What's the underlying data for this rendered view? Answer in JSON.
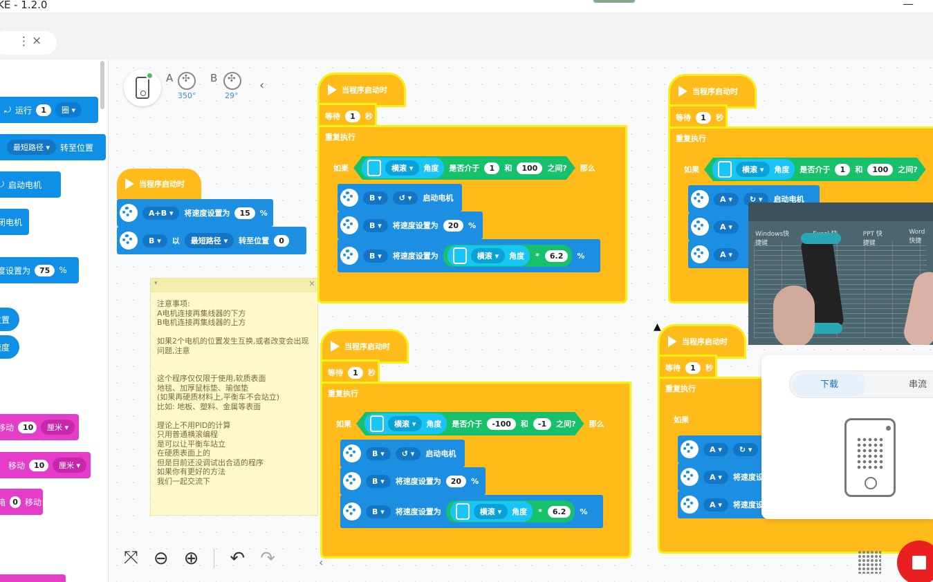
{
  "window": {
    "title": "KE - 1.2.0",
    "minimize": "—"
  },
  "tab": {
    "more": "⋮",
    "close": "×"
  },
  "palette": {
    "run_rotations_text": "运行",
    "run_value": "1",
    "run_unit": "圈",
    "shortest_path": "最短路径",
    "turn_to_position": "转至位置",
    "start_motor": "启动电机",
    "stop_motor": "关闭电机",
    "set_speed_text": "速度设置为",
    "set_speed_value": "75",
    "percent": "%",
    "position": "位置",
    "speed": "速度",
    "move_text": "移动",
    "move_value": "10",
    "move_unit": "厘米",
    "move2_text": "移动",
    "move2_value": "10",
    "move2_unit": "厘米",
    "move3_label": "箱",
    "move3_value": "0",
    "move3_text": "移动"
  },
  "hub_status": {
    "port_a": "A",
    "port_a_deg": "350°",
    "port_b": "B",
    "port_b_deg": "29°",
    "collapse": "‹"
  },
  "blocks": {
    "when_start": "当程序启动时",
    "wait": "等待",
    "wait_value": "1",
    "seconds": "秒",
    "repeat": "重复执行",
    "if": "如果",
    "then": "那么",
    "roll": "横滚",
    "angle": "角度",
    "is_between": "是否介于",
    "and": "和",
    "between_end": "之间?",
    "start_motor": "启动电机",
    "set_speed": "将速度设置为",
    "speed_20": "20",
    "percent": "%",
    "mult_symbol": "*",
    "mult_value": "6.2",
    "stack1": {
      "low": "1",
      "high": "100"
    },
    "stack2": {
      "low": "-100",
      "high": "-1"
    },
    "side_ab": "A+B",
    "side_speed": "15",
    "side_with": "以",
    "side_path": "最短路径",
    "side_turn_to": "转至位置",
    "side_pos": "0",
    "port_a": "A",
    "port_b": "B"
  },
  "note": {
    "text": "注意事项:\nA电机连接再集线器的下方\nB电机连接再集线器的上方\n\n如果2个电机的位置发生互换,或者改变会出现问题,注意\n\n\n这个程序仅仅限于使用,软质表面\n地毯、加厚鼠标垫、瑜伽垫\n(如果再硬质材料上,平衡车不会站立)\n比如: 地板、塑料、金属等表面\n\n理论上不用PID的计算\n只用普通横滚编程\n是可以让平衡车站立\n在硬质表面上的\n但是目前还没调试出合适的程序\n如果你有更好的方法\n我们一起交流下",
    "close": "×",
    "toggle": "▾"
  },
  "video": {
    "headers": [
      "Windows快捷键",
      "Excel 快捷键",
      "PPT 快捷键",
      "Word 快捷"
    ]
  },
  "download_panel": {
    "download": "下载",
    "stream": "串流"
  },
  "toolbar": {
    "fit": "⤧",
    "zoom_out": "⊖",
    "zoom_in": "⊕",
    "undo": "↶",
    "redo": "↷",
    "collapse": "‹"
  }
}
